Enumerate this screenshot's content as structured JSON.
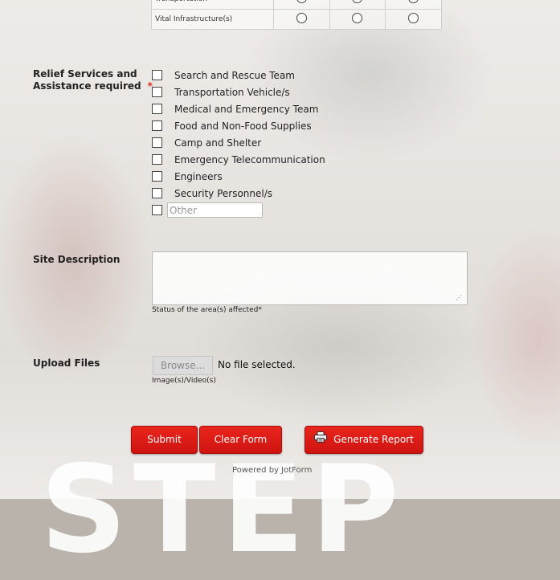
{
  "matrix": {
    "rows": [
      "Transportation",
      "Vital Infrastructure(s)"
    ]
  },
  "relief": {
    "label_line1": "Relief Services and",
    "label_line2": "Assistance required",
    "required_mark": "*",
    "options": [
      "Search and Rescue Team",
      "Transportation Vehicle/s",
      "Medical and Emergency Team",
      "Food and Non-Food Supplies",
      "Camp and Shelter",
      "Emergency Telecommunication",
      "Engineers",
      "Security Personnel/s"
    ],
    "other_placeholder": "Other"
  },
  "site_description": {
    "label": "Site Description",
    "value": "",
    "sublabel": "Status of the area(s) affected*"
  },
  "upload": {
    "label": "Upload Files",
    "browse_label": "Browse...",
    "status": "No file selected.",
    "sublabel": "Image(s)/Video(s)"
  },
  "buttons": {
    "submit": "Submit",
    "clear": "Clear Form",
    "report": "Generate Report"
  },
  "footer": {
    "powered_by": "Powered by JotForm"
  },
  "background_watermark": "STEP",
  "colors": {
    "accent": "#e0261e",
    "button": "#d8180f"
  }
}
